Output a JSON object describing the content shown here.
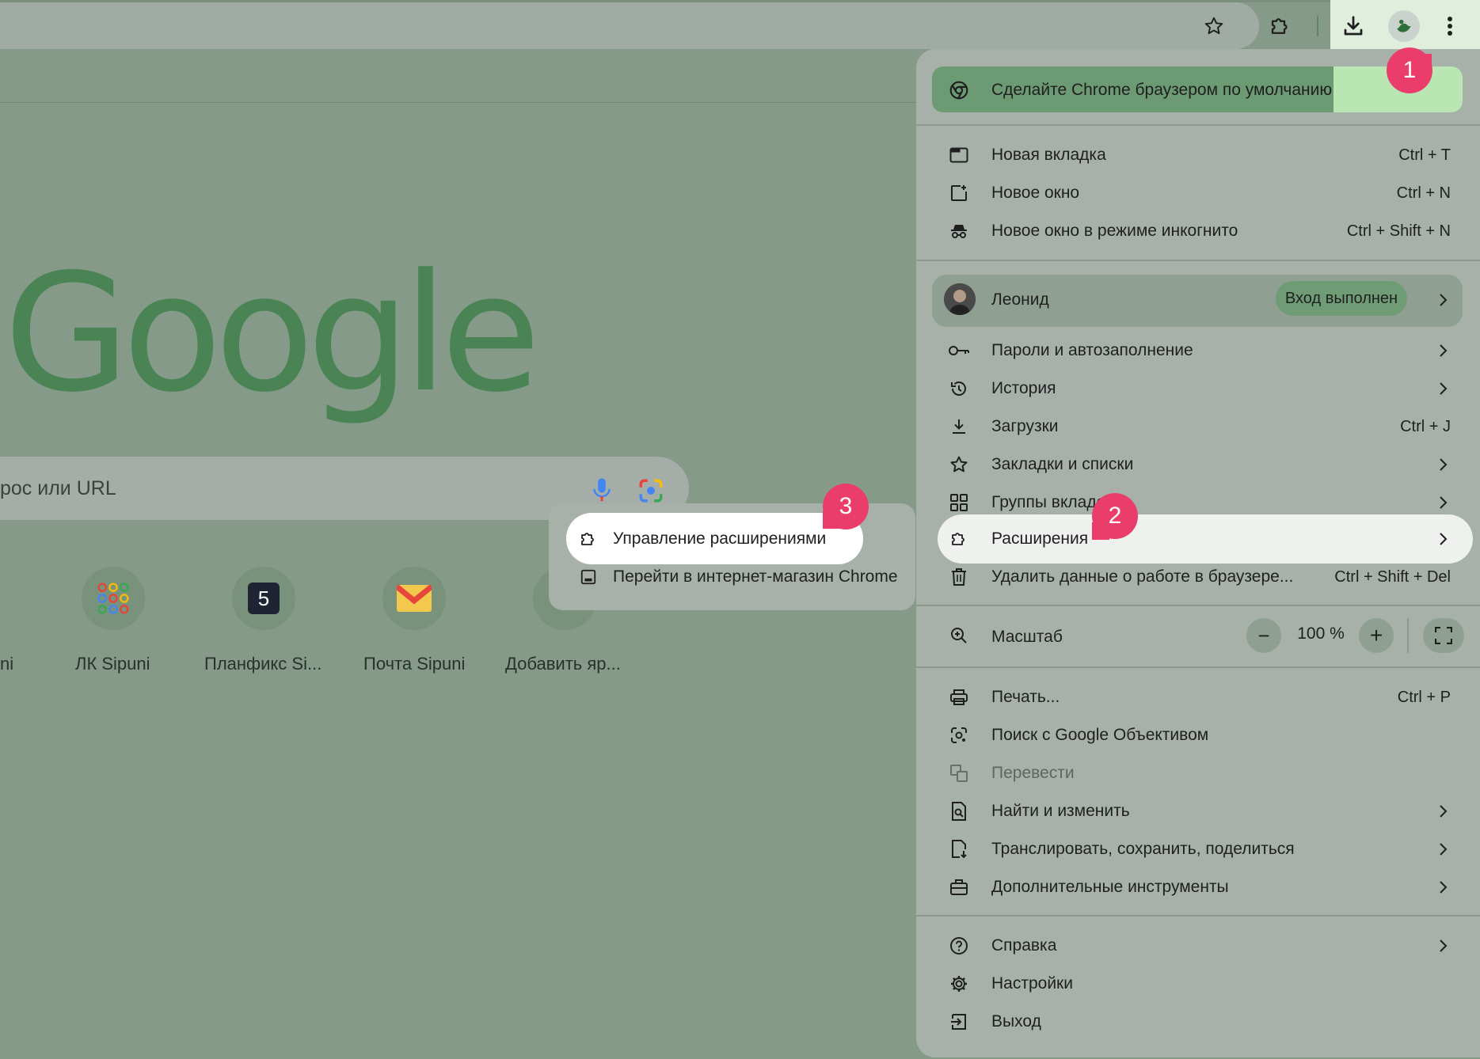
{
  "toolbar": {
    "star_icon": "star-icon",
    "extensions_icon": "puzzle-icon",
    "downloads_icon": "download-icon",
    "menu_icon": "three-dots-vertical-icon"
  },
  "newtab": {
    "logo": "Google",
    "search_placeholder": "рос или URL",
    "shortcuts": [
      {
        "label": "ni"
      },
      {
        "label": "ЛК Sipuni"
      },
      {
        "label": "Планфикс Si..."
      },
      {
        "label": "Почта Sipuni"
      },
      {
        "label": "Добавить яр..."
      }
    ],
    "planfix_glyph": "5"
  },
  "menu": {
    "promo": "Сделайте Chrome браузером по умолчанию",
    "items": {
      "new_tab": {
        "label": "Новая вкладка",
        "shortcut": "Ctrl + T"
      },
      "new_window": {
        "label": "Новое окно",
        "shortcut": "Ctrl + N"
      },
      "incognito": {
        "label": "Новое окно в режиме инкогнито",
        "shortcut": "Ctrl + Shift + N"
      },
      "profile": {
        "label": "Леонид",
        "badge": "Вход выполнен"
      },
      "passwords": {
        "label": "Пароли и автозаполнение"
      },
      "history": {
        "label": "История"
      },
      "downloads": {
        "label": "Загрузки",
        "shortcut": "Ctrl + J"
      },
      "bookmarks": {
        "label": "Закладки и списки"
      },
      "tab_groups": {
        "label": "Группы вкладо"
      },
      "extensions": {
        "label": "Расширения"
      },
      "clear_data": {
        "label": "Удалить данные о работе в браузере...",
        "shortcut": "Ctrl + Shift + Del"
      },
      "zoom": {
        "label": "Масштаб",
        "value": "100 %",
        "minus": "−",
        "plus": "+"
      },
      "print": {
        "label": "Печать...",
        "shortcut": "Ctrl + P"
      },
      "lens": {
        "label": "Поиск с Google Объективом"
      },
      "translate": {
        "label": "Перевести"
      },
      "find": {
        "label": "Найти и изменить"
      },
      "cast": {
        "label": "Транслировать, сохранить, поделиться"
      },
      "more_tools": {
        "label": "Дополнительные инструменты"
      },
      "help": {
        "label": "Справка"
      },
      "settings": {
        "label": "Настройки"
      },
      "exit": {
        "label": "Выход"
      }
    }
  },
  "submenu": {
    "manage": "Управление расширениями",
    "webstore": "Перейти в интернет-магазин Chrome"
  },
  "callouts": {
    "one": "1",
    "two": "2",
    "three": "3"
  },
  "colors": {
    "callout": "#eb3d6c",
    "highlight": "#b9e6b2",
    "google_logo": "#4a8455"
  }
}
